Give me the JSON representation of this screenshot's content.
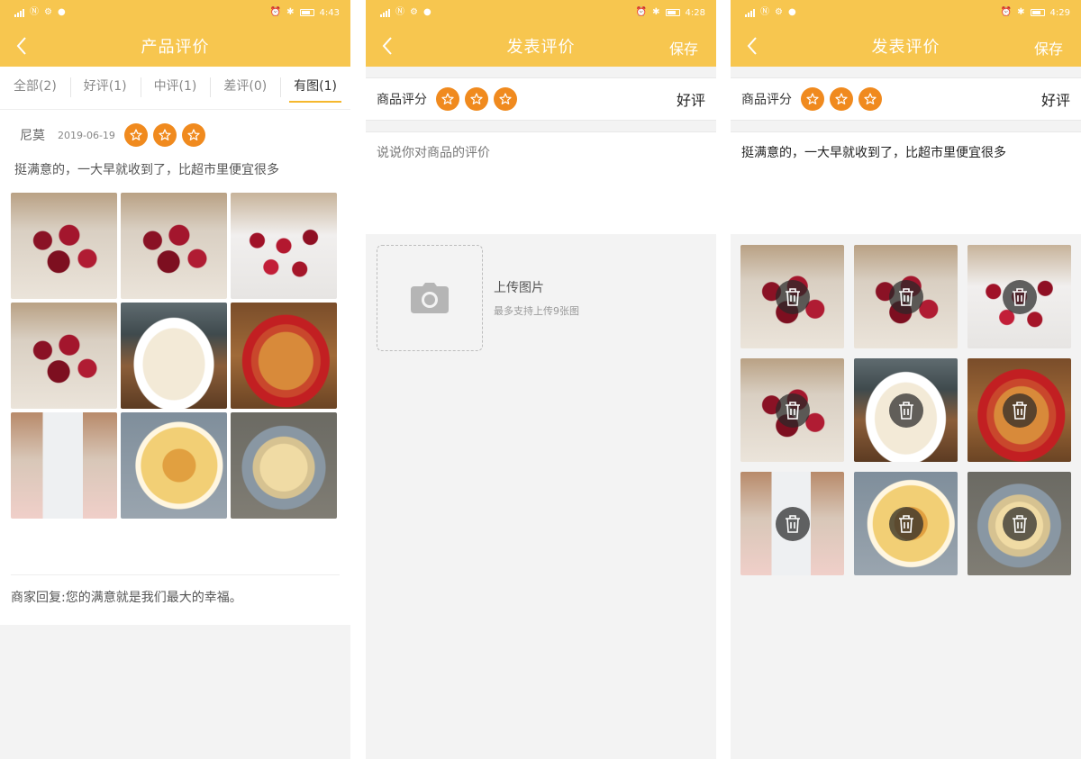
{
  "status_bars": [
    {
      "time": "4:43",
      "battery": "83"
    },
    {
      "time": "4:28",
      "battery": "46"
    },
    {
      "time": "4:29",
      "battery": "46"
    }
  ],
  "screen1": {
    "title": "产品评价",
    "tabs": [
      {
        "label": "全部(2)"
      },
      {
        "label": "好评(1)"
      },
      {
        "label": "中评(1)"
      },
      {
        "label": "差评(0)"
      },
      {
        "label": "有图(1)"
      }
    ],
    "active_tab": "有图(1)",
    "review": {
      "user": "尼莫",
      "date": "2019-06-19",
      "stars": 3,
      "text": "挺满意的，一大早就收到了，比超市里便宜很多",
      "photos": [
        "cherry",
        "cherry",
        "cherry-box",
        "cherry",
        "bowl-white",
        "bowl-red",
        "milk",
        "plate",
        "bowl-grey"
      ]
    },
    "reply": "商家回复:您的满意就是我们最大的幸福。"
  },
  "screen2": {
    "title": "发表评价",
    "save_label": "保存",
    "rating_label": "商品评分",
    "rating_value": "好评",
    "comment_placeholder": "说说你对商品的评价",
    "upload_title": "上传图片",
    "upload_hint": "最多支持上传9张图"
  },
  "screen3": {
    "title": "发表评价",
    "save_label": "保存",
    "rating_label": "商品评分",
    "rating_value": "好评",
    "comment_text": "挺满意的，一大早就收到了，比超市里便宜很多"
  },
  "colors": {
    "header": "#f7c64f",
    "star": "#f08a1e",
    "tab_underline": "#f5b82e"
  }
}
